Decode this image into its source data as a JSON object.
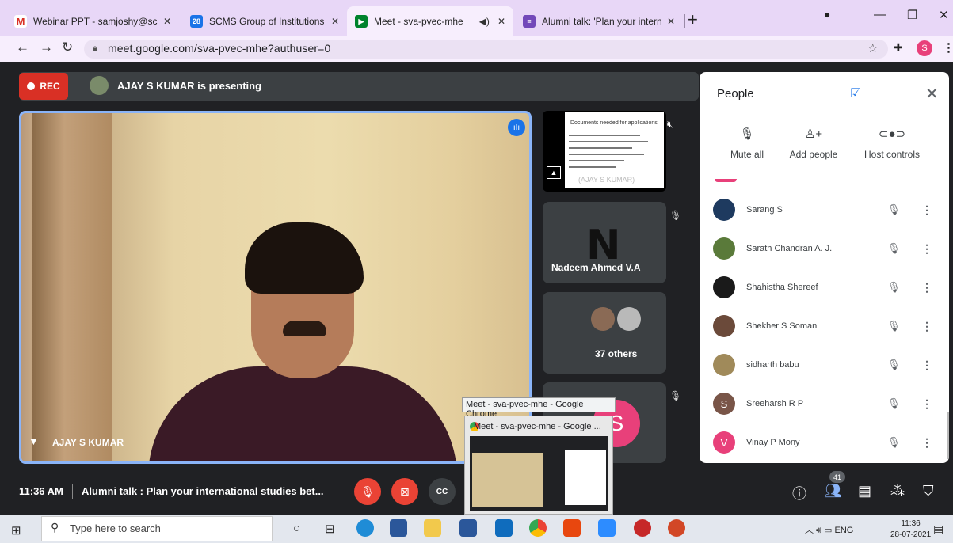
{
  "browser": {
    "tabs": [
      {
        "title": "Webinar PPT - samjoshy@scmsg",
        "icon": "gmail-icon",
        "color": "#d93025"
      },
      {
        "title": "SCMS Group of Institutions - Cal",
        "icon": "calendar-icon",
        "color": "#1a73e8",
        "badge": "28"
      },
      {
        "title": "Meet - sva-pvec-mhe",
        "icon": "meet-icon",
        "color": "#f9ab00"
      },
      {
        "title": "Alumni talk: 'Plan your internatio",
        "icon": "forms-icon",
        "color": "#7248b9"
      }
    ],
    "url": "meet.google.com/sva-pvec-mhe?authuser=0",
    "profile_initial": "S"
  },
  "meet": {
    "rec_label": "REC",
    "presenting_text": "AJAY S KUMAR is presenting",
    "main_speaker": "AJAY S KUMAR",
    "slide": {
      "title": "Documents needed for applications",
      "owner": "(AJAY S KUMAR)"
    },
    "tiles": [
      {
        "name": "Nadeem Ahmed V.A"
      },
      {
        "name": "37 others"
      }
    ],
    "clock": "11:36 AM",
    "meeting_title": "Alumni talk : Plan your international studies bet...",
    "participant_count": "41"
  },
  "people_panel": {
    "title": "People",
    "controls": [
      {
        "label": "Mute all",
        "icon": "mic-off-icon"
      },
      {
        "label": "Add people",
        "icon": "add-person-icon"
      },
      {
        "label": "Host controls",
        "icon": "toggle-icon"
      }
    ],
    "participants": [
      {
        "name": "Sarang S",
        "avatar_color": "#1e3a5f",
        "initial": ""
      },
      {
        "name": "Sarath Chandran A. J.",
        "avatar_color": "#5a7a3a",
        "initial": ""
      },
      {
        "name": "Shahistha Shereef",
        "avatar_color": "#1a1a1a",
        "initial": ""
      },
      {
        "name": "Shekher S Soman",
        "avatar_color": "#6b4a3a",
        "initial": ""
      },
      {
        "name": "sidharth babu",
        "avatar_color": "#a08a5a",
        "initial": ""
      },
      {
        "name": "Sreeharsh R P",
        "avatar_color": "#795548",
        "initial": "S"
      },
      {
        "name": "Vinay P Mony",
        "avatar_color": "#e8407a",
        "initial": "V"
      }
    ]
  },
  "tooltip": "Meet - sva-pvec-mhe - Google Chrome",
  "preview_title": "Meet - sva-pvec-mhe - Google ...",
  "taskbar": {
    "search_placeholder": "Type here to search",
    "lang": "ENG",
    "time": "11:36",
    "date": "28-07-2021"
  }
}
